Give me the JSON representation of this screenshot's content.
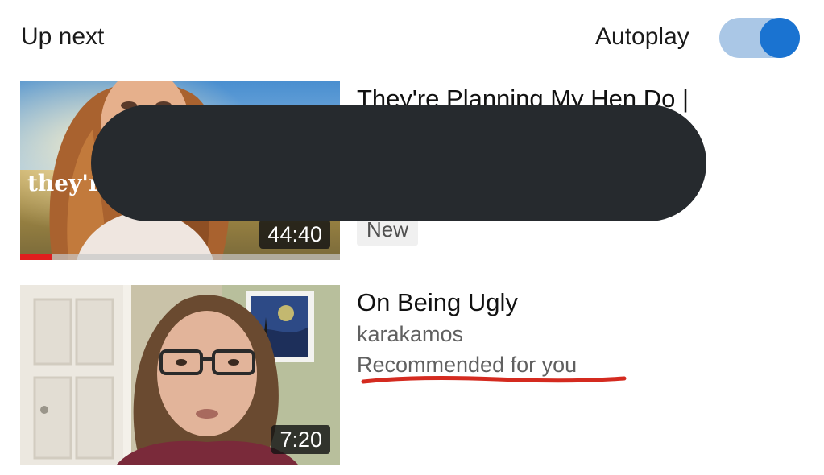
{
  "header": {
    "title": "Up next",
    "autoplay_label": "Autoplay",
    "autoplay_on": true
  },
  "colors": {
    "toggle_track": "#aac7e6",
    "toggle_knob": "#1a73d1",
    "progress": "#e01e1e",
    "redaction": "#262a2e",
    "annotation": "#d42a1f"
  },
  "videos": [
    {
      "title": "They're Planning My Hen Do |",
      "thumbnail_overlay_text": "they'r",
      "duration": "44:40",
      "badge": "New",
      "watched_fraction": 0.1
    },
    {
      "title": "On Being Ugly",
      "channel": "karakamos",
      "reason": "Recommended for you",
      "duration": "7:20"
    }
  ]
}
